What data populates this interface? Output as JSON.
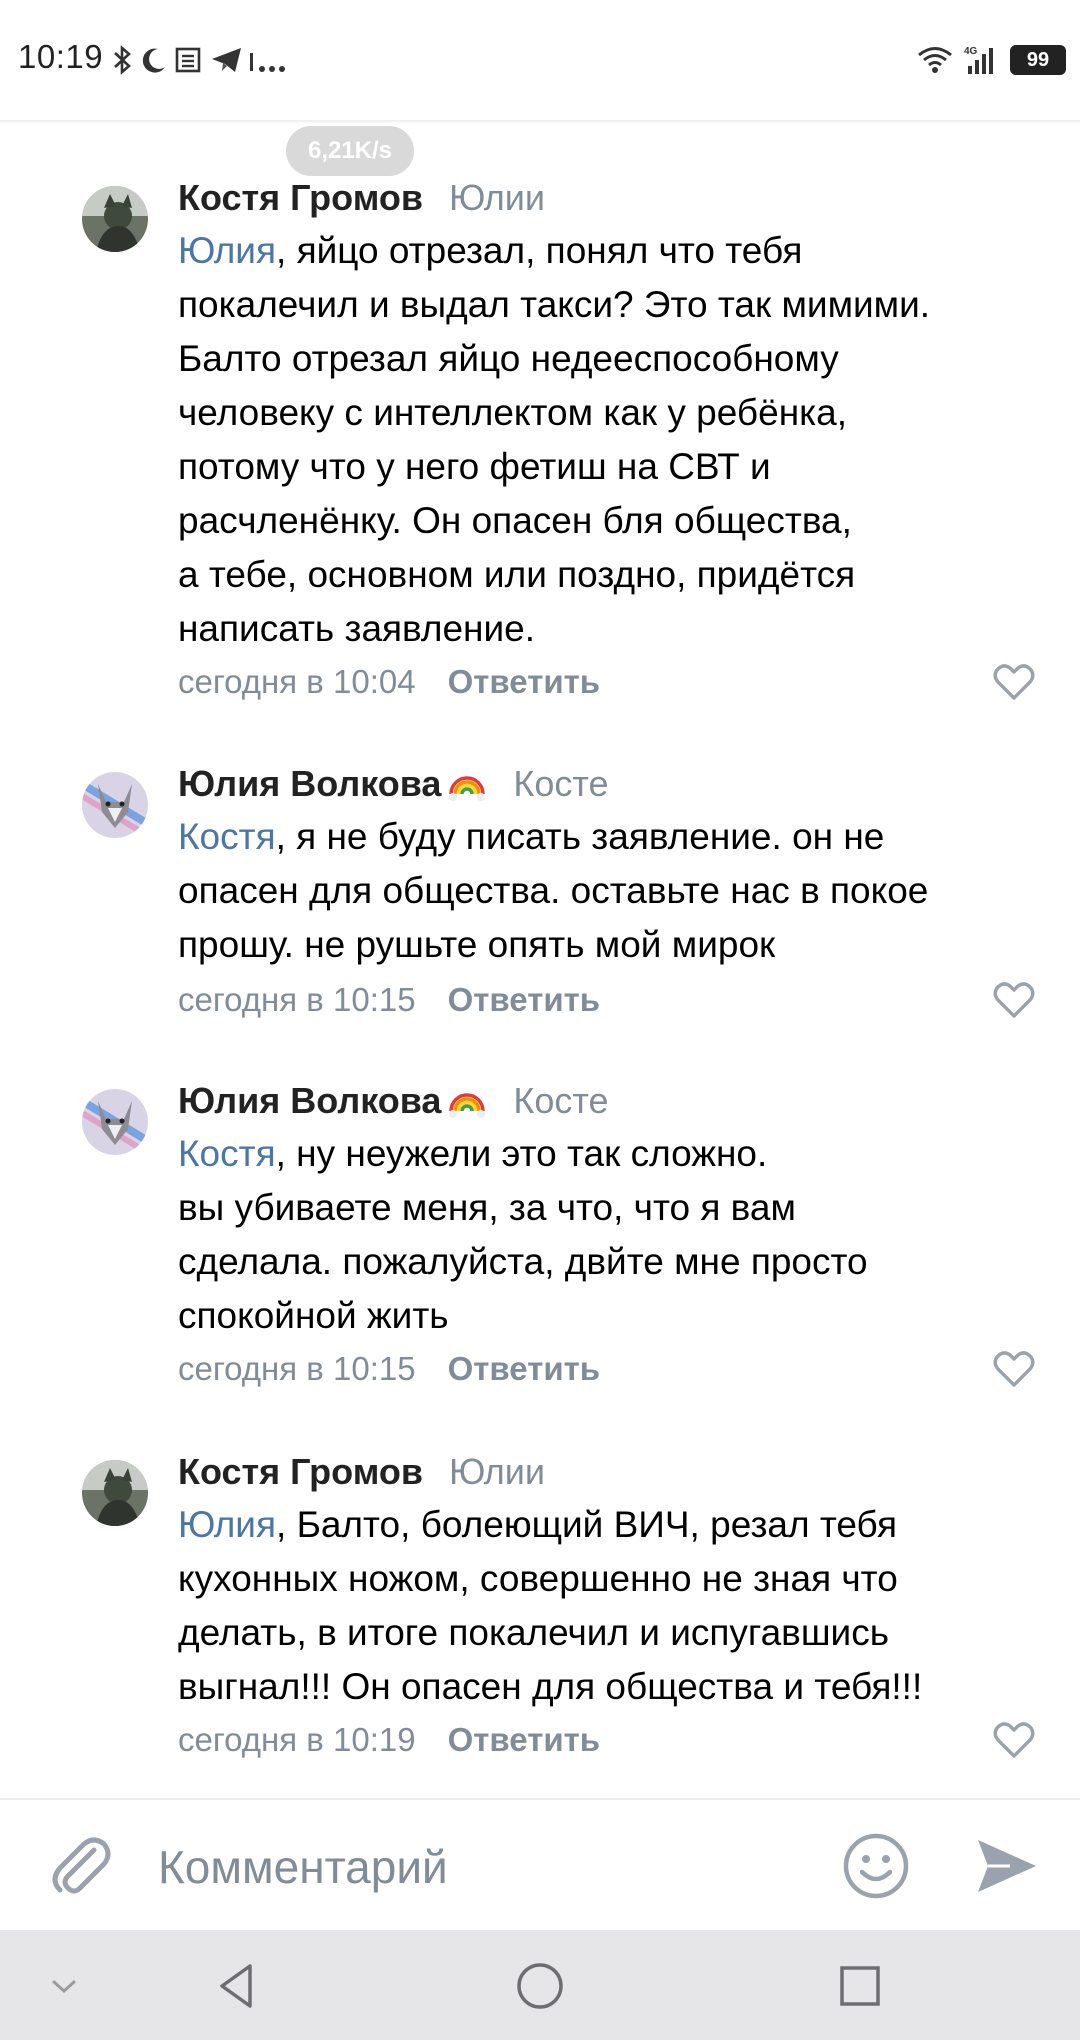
{
  "status_bar": {
    "time": "10:19",
    "left_icons": [
      "bluetooth-icon",
      "moon-icon",
      "news-icon",
      "telegram-icon",
      "more-notifications-icon"
    ],
    "right_icons": [
      "wifi-icon",
      "signal-4g-icon"
    ],
    "battery": "99"
  },
  "speed_indicator": "6,21K/s",
  "comments": [
    {
      "author": "Костя Громов",
      "reply_to": "Юлии",
      "mention": "Юлия",
      "text": ", яйцо отрезал, понял что тебя\nпокалечил и выдал такси? Это так мимими.\nБалто отрезал яйцо недееспособному\nчеловеку с интеллектом как у ребёнка,\nпотому что у него фетиш на СВТ и\nрасчленёнку. Он опасен бля общества,\nа тебе, основном или поздно, придётся\nнаписать заявление.",
      "date": "сегодня в 10:04",
      "reply_label": "Ответить",
      "has_badge": false
    },
    {
      "author": "Юлия Волкова",
      "reply_to": "Косте",
      "mention": "Костя",
      "text": ", я не буду писать заявление. он не\nопасен для общества. оставьте нас в покое\nпрошу. не рушьте опять мой мирок",
      "date": "сегодня в 10:15",
      "reply_label": "Ответить",
      "has_badge": true
    },
    {
      "author": "Юлия Волкова",
      "reply_to": "Косте",
      "mention": "Костя",
      "text": ", ну неужели это так сложно.\nвы убиваете меня, за что, что я вам\nсделала. пожалуйста, двйте мне просто\nспокойной жить",
      "date": "сегодня в 10:15",
      "reply_label": "Ответить",
      "has_badge": true
    },
    {
      "author": "Костя Громов",
      "reply_to": "Юлии",
      "mention": "Юлия",
      "text": ", Балто, болеющий ВИЧ, резал тебя\nкухонных ножом, совершенно не зная что\nделать, в итоге покалечил и испугавшись\nвыгнал!!! Он опасен для общества и тебя!!!",
      "date": "сегодня в 10:19",
      "reply_label": "Ответить",
      "has_badge": false
    }
  ],
  "compose": {
    "placeholder": "Комментарий"
  },
  "colors": {
    "link": "#4a76a8",
    "secondary": "#818c99",
    "icon": "#99a2ad"
  }
}
